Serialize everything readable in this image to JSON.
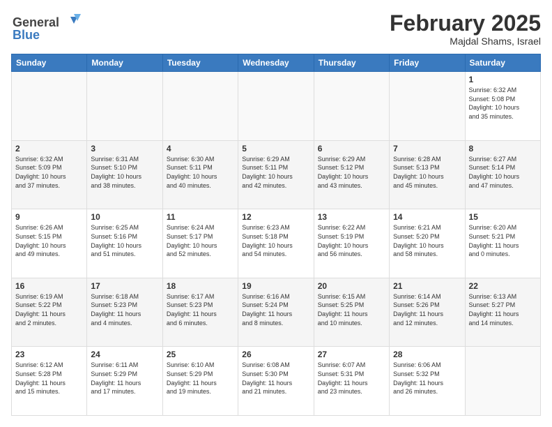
{
  "logo": {
    "line1": "General",
    "line2": "Blue"
  },
  "header": {
    "month": "February 2025",
    "location": "Majdal Shams, Israel"
  },
  "weekdays": [
    "Sunday",
    "Monday",
    "Tuesday",
    "Wednesday",
    "Thursday",
    "Friday",
    "Saturday"
  ],
  "weeks": [
    [
      {
        "day": "",
        "info": ""
      },
      {
        "day": "",
        "info": ""
      },
      {
        "day": "",
        "info": ""
      },
      {
        "day": "",
        "info": ""
      },
      {
        "day": "",
        "info": ""
      },
      {
        "day": "",
        "info": ""
      },
      {
        "day": "1",
        "info": "Sunrise: 6:32 AM\nSunset: 5:08 PM\nDaylight: 10 hours\nand 35 minutes."
      }
    ],
    [
      {
        "day": "2",
        "info": "Sunrise: 6:32 AM\nSunset: 5:09 PM\nDaylight: 10 hours\nand 37 minutes."
      },
      {
        "day": "3",
        "info": "Sunrise: 6:31 AM\nSunset: 5:10 PM\nDaylight: 10 hours\nand 38 minutes."
      },
      {
        "day": "4",
        "info": "Sunrise: 6:30 AM\nSunset: 5:11 PM\nDaylight: 10 hours\nand 40 minutes."
      },
      {
        "day": "5",
        "info": "Sunrise: 6:29 AM\nSunset: 5:11 PM\nDaylight: 10 hours\nand 42 minutes."
      },
      {
        "day": "6",
        "info": "Sunrise: 6:29 AM\nSunset: 5:12 PM\nDaylight: 10 hours\nand 43 minutes."
      },
      {
        "day": "7",
        "info": "Sunrise: 6:28 AM\nSunset: 5:13 PM\nDaylight: 10 hours\nand 45 minutes."
      },
      {
        "day": "8",
        "info": "Sunrise: 6:27 AM\nSunset: 5:14 PM\nDaylight: 10 hours\nand 47 minutes."
      }
    ],
    [
      {
        "day": "9",
        "info": "Sunrise: 6:26 AM\nSunset: 5:15 PM\nDaylight: 10 hours\nand 49 minutes."
      },
      {
        "day": "10",
        "info": "Sunrise: 6:25 AM\nSunset: 5:16 PM\nDaylight: 10 hours\nand 51 minutes."
      },
      {
        "day": "11",
        "info": "Sunrise: 6:24 AM\nSunset: 5:17 PM\nDaylight: 10 hours\nand 52 minutes."
      },
      {
        "day": "12",
        "info": "Sunrise: 6:23 AM\nSunset: 5:18 PM\nDaylight: 10 hours\nand 54 minutes."
      },
      {
        "day": "13",
        "info": "Sunrise: 6:22 AM\nSunset: 5:19 PM\nDaylight: 10 hours\nand 56 minutes."
      },
      {
        "day": "14",
        "info": "Sunrise: 6:21 AM\nSunset: 5:20 PM\nDaylight: 10 hours\nand 58 minutes."
      },
      {
        "day": "15",
        "info": "Sunrise: 6:20 AM\nSunset: 5:21 PM\nDaylight: 11 hours\nand 0 minutes."
      }
    ],
    [
      {
        "day": "16",
        "info": "Sunrise: 6:19 AM\nSunset: 5:22 PM\nDaylight: 11 hours\nand 2 minutes."
      },
      {
        "day": "17",
        "info": "Sunrise: 6:18 AM\nSunset: 5:23 PM\nDaylight: 11 hours\nand 4 minutes."
      },
      {
        "day": "18",
        "info": "Sunrise: 6:17 AM\nSunset: 5:23 PM\nDaylight: 11 hours\nand 6 minutes."
      },
      {
        "day": "19",
        "info": "Sunrise: 6:16 AM\nSunset: 5:24 PM\nDaylight: 11 hours\nand 8 minutes."
      },
      {
        "day": "20",
        "info": "Sunrise: 6:15 AM\nSunset: 5:25 PM\nDaylight: 11 hours\nand 10 minutes."
      },
      {
        "day": "21",
        "info": "Sunrise: 6:14 AM\nSunset: 5:26 PM\nDaylight: 11 hours\nand 12 minutes."
      },
      {
        "day": "22",
        "info": "Sunrise: 6:13 AM\nSunset: 5:27 PM\nDaylight: 11 hours\nand 14 minutes."
      }
    ],
    [
      {
        "day": "23",
        "info": "Sunrise: 6:12 AM\nSunset: 5:28 PM\nDaylight: 11 hours\nand 15 minutes."
      },
      {
        "day": "24",
        "info": "Sunrise: 6:11 AM\nSunset: 5:29 PM\nDaylight: 11 hours\nand 17 minutes."
      },
      {
        "day": "25",
        "info": "Sunrise: 6:10 AM\nSunset: 5:29 PM\nDaylight: 11 hours\nand 19 minutes."
      },
      {
        "day": "26",
        "info": "Sunrise: 6:08 AM\nSunset: 5:30 PM\nDaylight: 11 hours\nand 21 minutes."
      },
      {
        "day": "27",
        "info": "Sunrise: 6:07 AM\nSunset: 5:31 PM\nDaylight: 11 hours\nand 23 minutes."
      },
      {
        "day": "28",
        "info": "Sunrise: 6:06 AM\nSunset: 5:32 PM\nDaylight: 11 hours\nand 26 minutes."
      },
      {
        "day": "",
        "info": ""
      }
    ]
  ]
}
